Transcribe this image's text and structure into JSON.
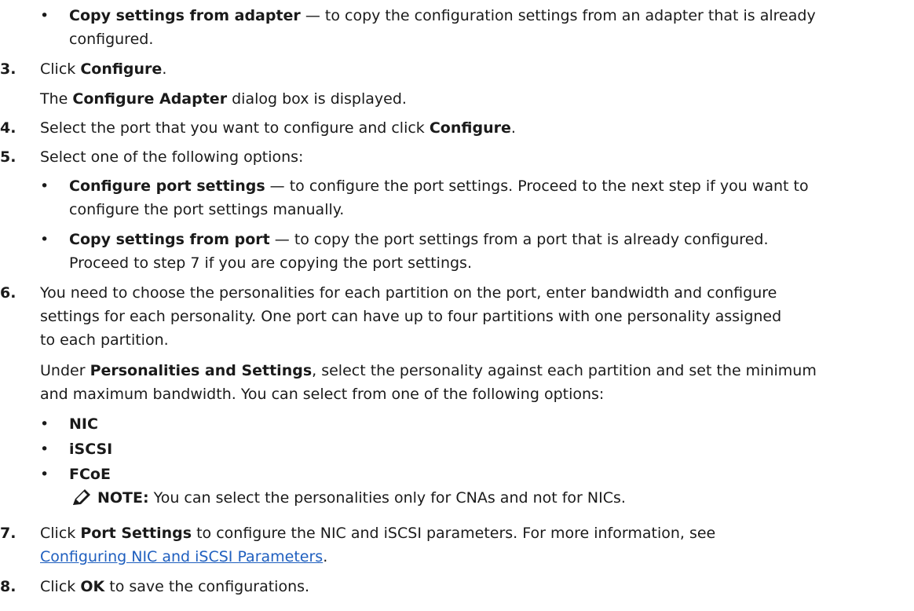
{
  "bullet_top": {
    "bold": "Copy settings from adapter",
    "text1": " — to copy the configuration settings from an adapter that is already",
    "text2": "configured."
  },
  "step3": {
    "num": "3.",
    "pre": "Click ",
    "bold": "Configure",
    "post": ".",
    "sub_pre": "The ",
    "sub_bold": "Configure Adapter",
    "sub_post": " dialog box is displayed."
  },
  "step4": {
    "num": "4.",
    "pre": "Select the port that you want to configure and click ",
    "bold": "Configure",
    "post": "."
  },
  "step5": {
    "num": "5.",
    "text": "Select one of the following options:",
    "opt1_bold": "Configure port settings",
    "opt1_text1": " — to configure the port settings. Proceed to the next step if you want to",
    "opt1_text2": "configure the port settings manually.",
    "opt2_bold": "Copy settings from port",
    "opt2_text1": " — to copy the port settings from a port that is already configured.",
    "opt2_text2": "Proceed to step 7 if you are copying the port settings."
  },
  "step6": {
    "num": "6.",
    "line1": "You need to choose the personalities for each partition on the port, enter bandwidth and configure",
    "line2": "settings for each personality. One port can have up to four partitions with one personality assigned",
    "line3": "to each partition.",
    "under_pre": "Under ",
    "under_bold": "Personalities and Settings",
    "under_post": ", select the personality against each partition and set the minimum",
    "under_line2": "and maximum bandwidth. You can select from one of the following options:",
    "options": [
      "NIC",
      "iSCSI",
      "FCoE"
    ],
    "note_label": "NOTE:",
    "note_text": " You can select the personalities only for CNAs and not for NICs."
  },
  "step7": {
    "num": "7.",
    "pre": "Click ",
    "bold": "Port Settings",
    "post": " to configure the NIC and iSCSI parameters. For more information, see",
    "link": "Configuring NIC and iSCSI Parameters",
    "link_post": "."
  },
  "step8": {
    "num": "8.",
    "pre": "Click ",
    "bold": "OK",
    "post": " to save the configurations."
  },
  "icons": {
    "note": "pencil-note-icon"
  },
  "colors": {
    "link": "#1f5fbf",
    "text": "#1a1a1a"
  }
}
